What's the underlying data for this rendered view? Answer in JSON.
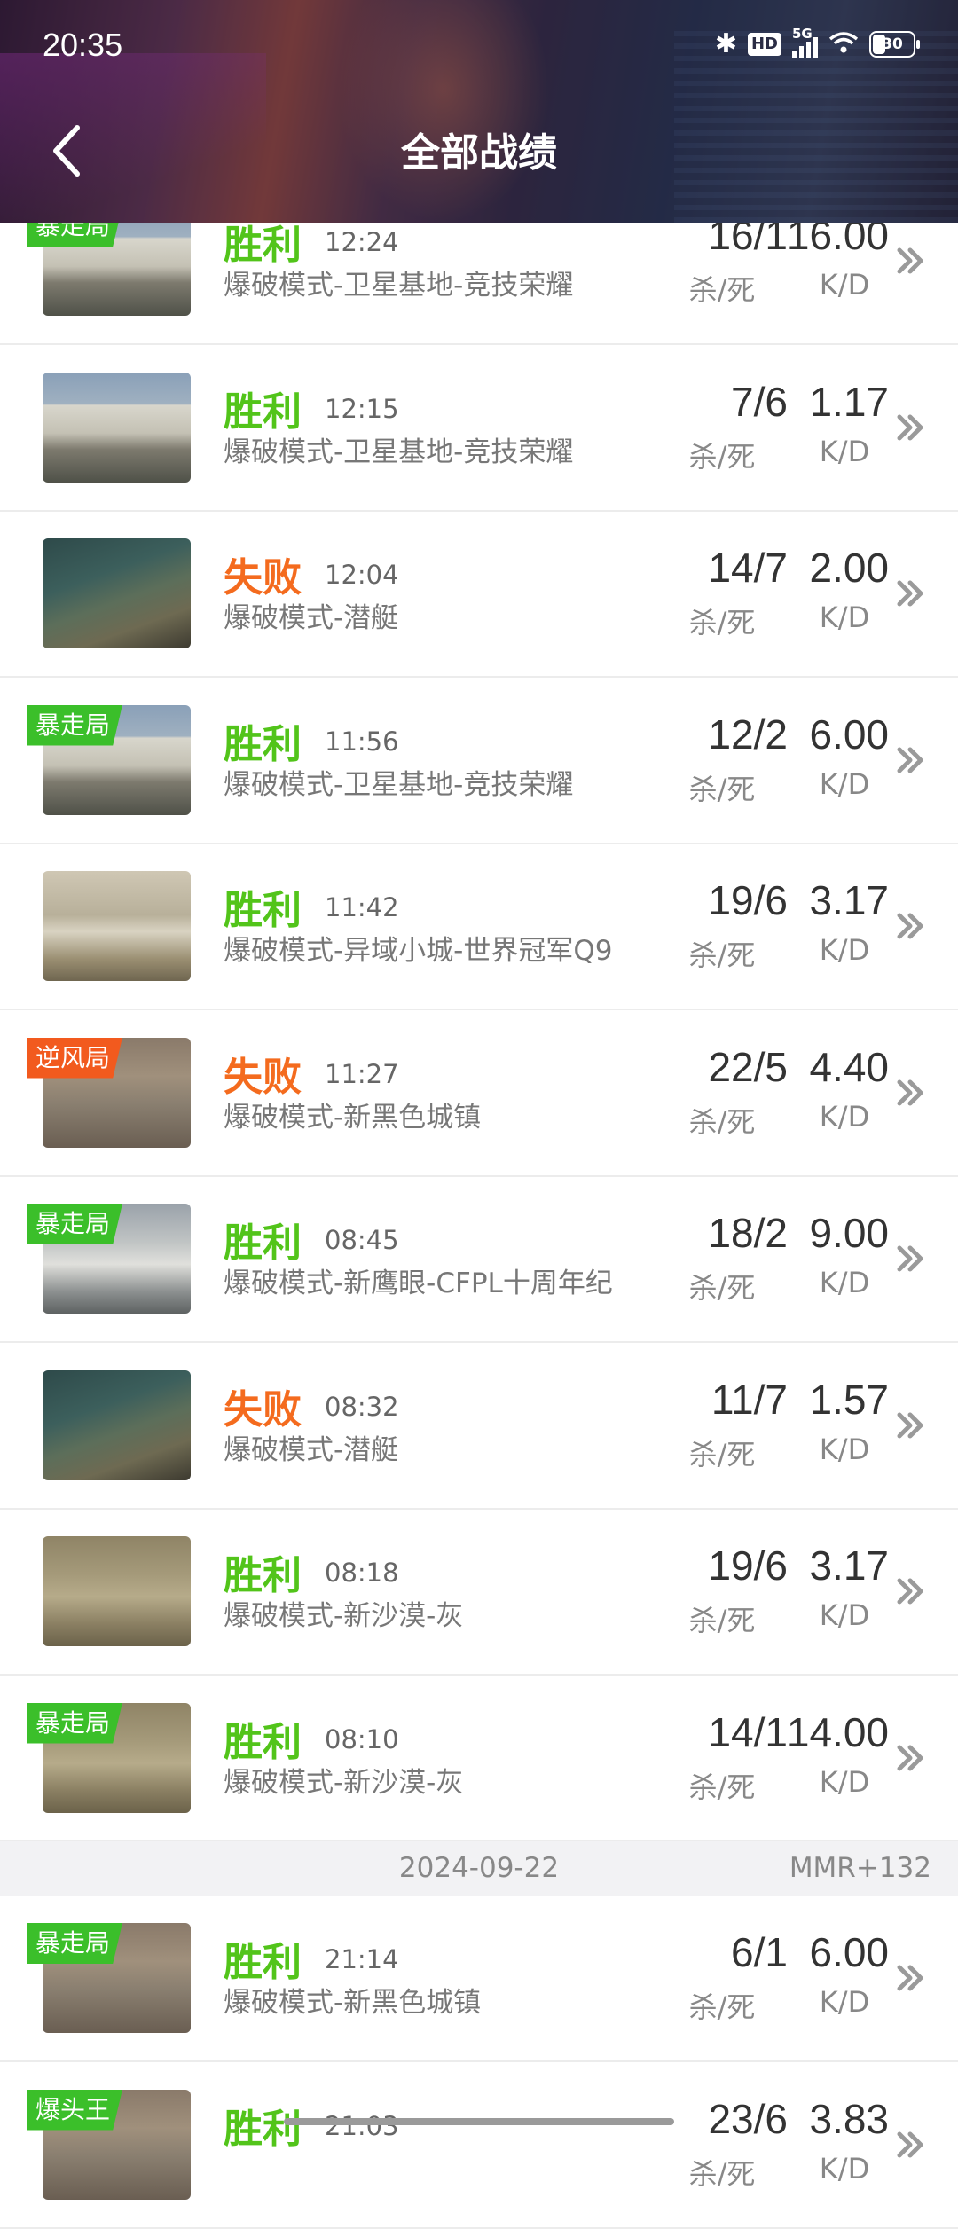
{
  "status_bar": {
    "time": "20:35",
    "hd": "HD",
    "network": "5G",
    "battery": "30"
  },
  "header": {
    "title": "全部战绩",
    "back_icon": "chevron-left-icon"
  },
  "labels": {
    "kd_ratio_label": "杀/死",
    "kd_label": "K/D"
  },
  "colors": {
    "win": "#52c41a",
    "lose": "#f46b1e",
    "badge_green": "#3bbf2a",
    "badge_orange": "#f25a1e"
  },
  "matches": [
    {
      "result": "胜利",
      "outcome": "win",
      "time": "12:24",
      "mode": "爆破模式-卫星基地-竞技荣耀",
      "kills_deaths": "16/1",
      "kd": "16.00",
      "badge": "暴走局",
      "thumb": "satellite"
    },
    {
      "result": "胜利",
      "outcome": "win",
      "time": "12:15",
      "mode": "爆破模式-卫星基地-竞技荣耀",
      "kills_deaths": "7/6",
      "kd": "1.17",
      "badge": "",
      "thumb": "satellite"
    },
    {
      "result": "失败",
      "outcome": "lose",
      "time": "12:04",
      "mode": "爆破模式-潜艇",
      "kills_deaths": "14/7",
      "kd": "2.00",
      "badge": "",
      "thumb": "submarine"
    },
    {
      "result": "胜利",
      "outcome": "win",
      "time": "11:56",
      "mode": "爆破模式-卫星基地-竞技荣耀",
      "kills_deaths": "12/2",
      "kd": "6.00",
      "badge": "暴走局",
      "thumb": "satellite"
    },
    {
      "result": "胜利",
      "outcome": "win",
      "time": "11:42",
      "mode": "爆破模式-异域小城-世界冠军Q9",
      "kills_deaths": "19/6",
      "kd": "3.17",
      "badge": "",
      "thumb": "town"
    },
    {
      "result": "失败",
      "outcome": "lose",
      "time": "11:27",
      "mode": "爆破模式-新黑色城镇",
      "kills_deaths": "22/5",
      "kd": "4.40",
      "badge": "逆风局",
      "thumb": "blacktown"
    },
    {
      "result": "胜利",
      "outcome": "win",
      "time": "08:45",
      "mode": "爆破模式-新鹰眼-CFPL十周年纪",
      "kills_deaths": "18/2",
      "kd": "9.00",
      "badge": "暴走局",
      "thumb": "eagle"
    },
    {
      "result": "失败",
      "outcome": "lose",
      "time": "08:32",
      "mode": "爆破模式-潜艇",
      "kills_deaths": "11/7",
      "kd": "1.57",
      "badge": "",
      "thumb": "submarine"
    },
    {
      "result": "胜利",
      "outcome": "win",
      "time": "08:18",
      "mode": "爆破模式-新沙漠-灰",
      "kills_deaths": "19/6",
      "kd": "3.17",
      "badge": "",
      "thumb": "desert"
    },
    {
      "result": "胜利",
      "outcome": "win",
      "time": "08:10",
      "mode": "爆破模式-新沙漠-灰",
      "kills_deaths": "14/1",
      "kd": "14.00",
      "badge": "暴走局",
      "thumb": "desert"
    }
  ],
  "date_separator": {
    "date": "2024-09-22",
    "mmr": "MMR+132"
  },
  "matches_2": [
    {
      "result": "胜利",
      "outcome": "win",
      "time": "21:14",
      "mode": "爆破模式-新黑色城镇",
      "kills_deaths": "6/1",
      "kd": "6.00",
      "badge": "暴走局",
      "thumb": "blacktown"
    },
    {
      "result": "胜利",
      "outcome": "win",
      "time": "21:03",
      "mode": "",
      "kills_deaths": "23/6",
      "kd": "3.83",
      "badge": "爆头王",
      "thumb": "blacktown"
    }
  ]
}
